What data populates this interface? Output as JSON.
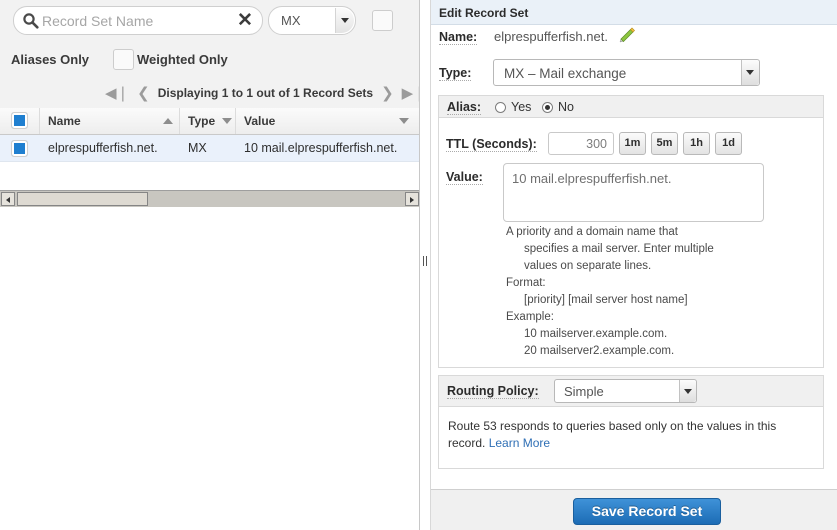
{
  "left": {
    "search": {
      "placeholder": "Record Set Name",
      "value": "",
      "clear_glyph": "✕"
    },
    "type_filter": {
      "selected": "MX"
    },
    "aliases_only_label": "Aliases Only",
    "weighted_only_label": "Weighted Only",
    "aliases_only_checked": false,
    "weighted_only_checked": false,
    "pager": {
      "first_glyph": "⏪",
      "prev_glyph": "❮",
      "text": "Displaying 1 to 1 out of 1 Record Sets",
      "next_glyph": "❯",
      "last_glyph": "⏩"
    },
    "table": {
      "columns": [
        "Name",
        "Type",
        "Value"
      ],
      "rows": [
        {
          "name": "elprespufferfish.net.",
          "type": "MX",
          "value": "10 mail.elprespufferfish.net.",
          "selected": true
        }
      ]
    }
  },
  "right": {
    "panel_title": "Edit Record Set",
    "name_label": "Name:",
    "name_value": "elprespufferfish.net.",
    "type_label": "Type:",
    "type_value": "MX – Mail exchange",
    "alias_label": "Alias:",
    "alias_yes_label": "Yes",
    "alias_no_label": "No",
    "alias_selected": "No",
    "ttl_label": "TTL (Seconds):",
    "ttl_value": "300",
    "ttl_presets": [
      "1m",
      "5m",
      "1h",
      "1d"
    ],
    "value_label": "Value:",
    "value_text": "10 mail.elprespufferfish.net.",
    "help": {
      "l1": "A priority and a domain name that",
      "l2": "specifies a mail server. Enter multiple",
      "l3": "values on separate lines.",
      "l4": "Format:",
      "l5": "[priority] [mail server host name]",
      "l6": "Example:",
      "l7": "10 mailserver.example.com.",
      "l8": "20 mailserver2.example.com."
    },
    "routing_label": "Routing Policy:",
    "routing_value": "Simple",
    "routing_note": "Route 53 responds to queries based only on the values in this record.",
    "routing_link": "Learn More",
    "save_label": "Save Record Set"
  },
  "colors": {
    "accent": "#1f7fd0",
    "link": "#2f6fb5",
    "row_selected": "#eaf1fb",
    "panel_header": "#eaf1f8",
    "toolbar": "#f2f2f2"
  }
}
